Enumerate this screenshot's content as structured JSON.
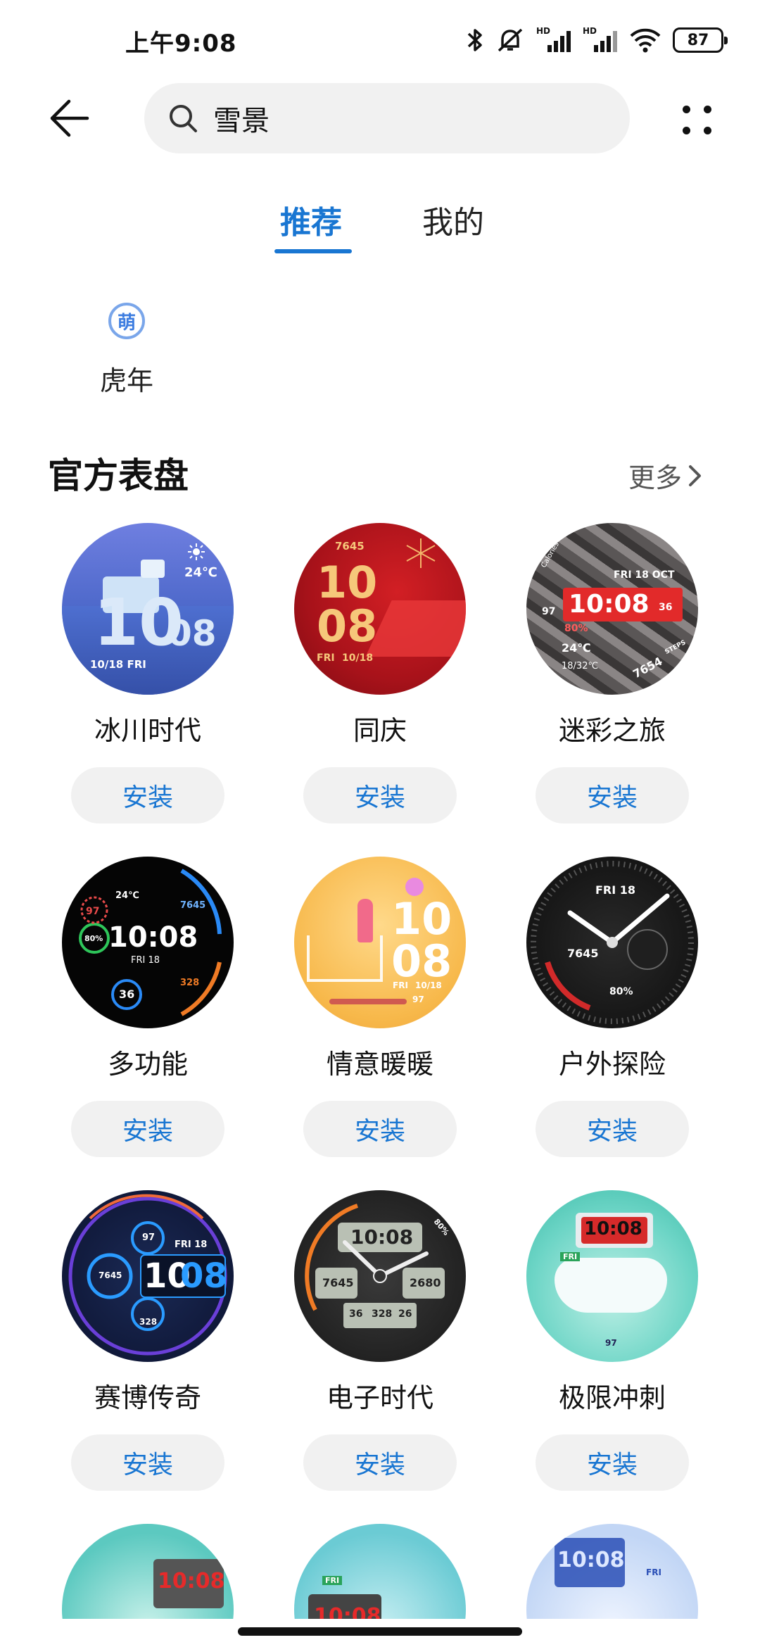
{
  "status_bar": {
    "time": "上午9:08",
    "battery": "87",
    "icons": [
      "bluetooth-icon",
      "mute-icon",
      "hd-signal-icon",
      "hd-signal-icon",
      "wifi-icon",
      "battery-icon"
    ]
  },
  "search": {
    "value": "雪景",
    "placeholder": ""
  },
  "tabs": [
    {
      "label": "推荐",
      "active": true
    },
    {
      "label": "我的",
      "active": false
    }
  ],
  "categories": [
    {
      "icon_text": "萌",
      "label": "虎年"
    }
  ],
  "section": {
    "title": "官方表盘",
    "more_label": "更多"
  },
  "install_label": "安装",
  "faces": [
    {
      "name": "冰川时代",
      "hour": "10",
      "minute": "08",
      "temp": "24℃",
      "date": "10/18 FRI",
      "theme": "glacier"
    },
    {
      "name": "同庆",
      "hour": "10",
      "minute": "08",
      "steps": "7645",
      "date": "10/18",
      "day": "FRI",
      "theme": "celebrate"
    },
    {
      "name": "迷彩之旅",
      "time": "10:08",
      "date": "FRI 18 OCT",
      "temp": "24℃",
      "range": "18/32℃",
      "heart": "97",
      "battery": "80%",
      "seconds": "36",
      "steps": "7654",
      "steps_unit": "STEPS",
      "calories": "Calories",
      "theme": "camo"
    },
    {
      "name": "多功能",
      "time": "10:08",
      "date": "FRI 18",
      "temp": "24℃",
      "heart": "97",
      "steps": "7645",
      "battery": "80%",
      "stress": "36",
      "calories": "328",
      "theme": "multi"
    },
    {
      "name": "情意暖暖",
      "hour": "10",
      "minute": "08",
      "date": "10/18",
      "day": "FRI",
      "heart": "97",
      "theme": "warm"
    },
    {
      "name": "户外探险",
      "date": "FRI 18",
      "steps": "7645",
      "battery": "80%",
      "theme": "outdoor"
    },
    {
      "name": "赛博传奇",
      "hour": "10",
      "minute": "08",
      "date": "FRI 18",
      "heart": "97",
      "steps": "7645",
      "calories": "328",
      "theme": "cyber"
    },
    {
      "name": "电子时代",
      "time": "10:08",
      "steps": "7645",
      "extra": "2680",
      "v1": "36",
      "v2": "328",
      "v3": "26",
      "battery": "80%",
      "theme": "electronic"
    },
    {
      "name": "极限冲刺",
      "time": "10:08",
      "day": "FRI",
      "heart": "97",
      "theme": "sprint"
    }
  ],
  "partial_row": [
    {
      "time": "10:08",
      "theme": "snow1"
    },
    {
      "time": "10:08",
      "day": "FRI",
      "theme": "snow2"
    },
    {
      "time": "10:08",
      "day": "FRI",
      "theme": "snow3"
    }
  ],
  "colors": {
    "accent": "#1976d2",
    "button_bg": "#f1f1f1",
    "category_ring": "#7aa6ea"
  }
}
